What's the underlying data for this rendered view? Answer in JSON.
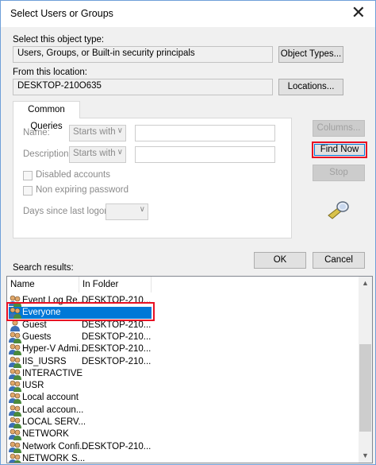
{
  "window": {
    "title": "Select Users or Groups",
    "close_glyph": "✕"
  },
  "object_type": {
    "label": "Select this object type:",
    "value": "Users, Groups, or Built-in security principals",
    "button": "Object Types..."
  },
  "location": {
    "label": "From this location:",
    "value": "DESKTOP-210O635",
    "button": "Locations..."
  },
  "tab": {
    "label": "Common Queries"
  },
  "queries": {
    "name_label": "Name:",
    "name_mode": "Starts with",
    "description_label": "Description:",
    "description_mode": "Starts with",
    "disabled_accounts": "Disabled accounts",
    "non_expiring": "Non expiring password",
    "days_label": "Days since last logon:"
  },
  "buttons": {
    "columns": "Columns...",
    "find_now": "Find Now",
    "stop": "Stop",
    "ok": "OK",
    "cancel": "Cancel"
  },
  "results": {
    "label": "Search results:",
    "columns": [
      "Name",
      "In Folder"
    ],
    "rows": [
      {
        "name": "Event Log Re...",
        "folder": "DESKTOP-210...",
        "icon": "group-icon"
      },
      {
        "name": "Everyone",
        "folder": "",
        "icon": "group-icon"
      },
      {
        "name": "Guest",
        "folder": "DESKTOP-210...",
        "icon": "user-icon"
      },
      {
        "name": "Guests",
        "folder": "DESKTOP-210...",
        "icon": "group-icon"
      },
      {
        "name": "Hyper-V Admi...",
        "folder": "DESKTOP-210...",
        "icon": "group-icon"
      },
      {
        "name": "IIS_IUSRS",
        "folder": "DESKTOP-210...",
        "icon": "group-icon"
      },
      {
        "name": "INTERACTIVE",
        "folder": "",
        "icon": "group-icon"
      },
      {
        "name": "IUSR",
        "folder": "",
        "icon": "group-icon"
      },
      {
        "name": "Local account",
        "folder": "",
        "icon": "group-icon"
      },
      {
        "name": "Local accoun...",
        "folder": "",
        "icon": "group-icon"
      },
      {
        "name": "LOCAL SERV...",
        "folder": "",
        "icon": "group-icon"
      },
      {
        "name": "NETWORK",
        "folder": "",
        "icon": "group-icon"
      },
      {
        "name": "Network Confi...",
        "folder": "DESKTOP-210...",
        "icon": "group-icon"
      },
      {
        "name": "NETWORK S...",
        "folder": "",
        "icon": "group-icon"
      }
    ],
    "selected_index": 1
  },
  "colors": {
    "highlight": "#e81123",
    "selection": "#0078d7"
  }
}
